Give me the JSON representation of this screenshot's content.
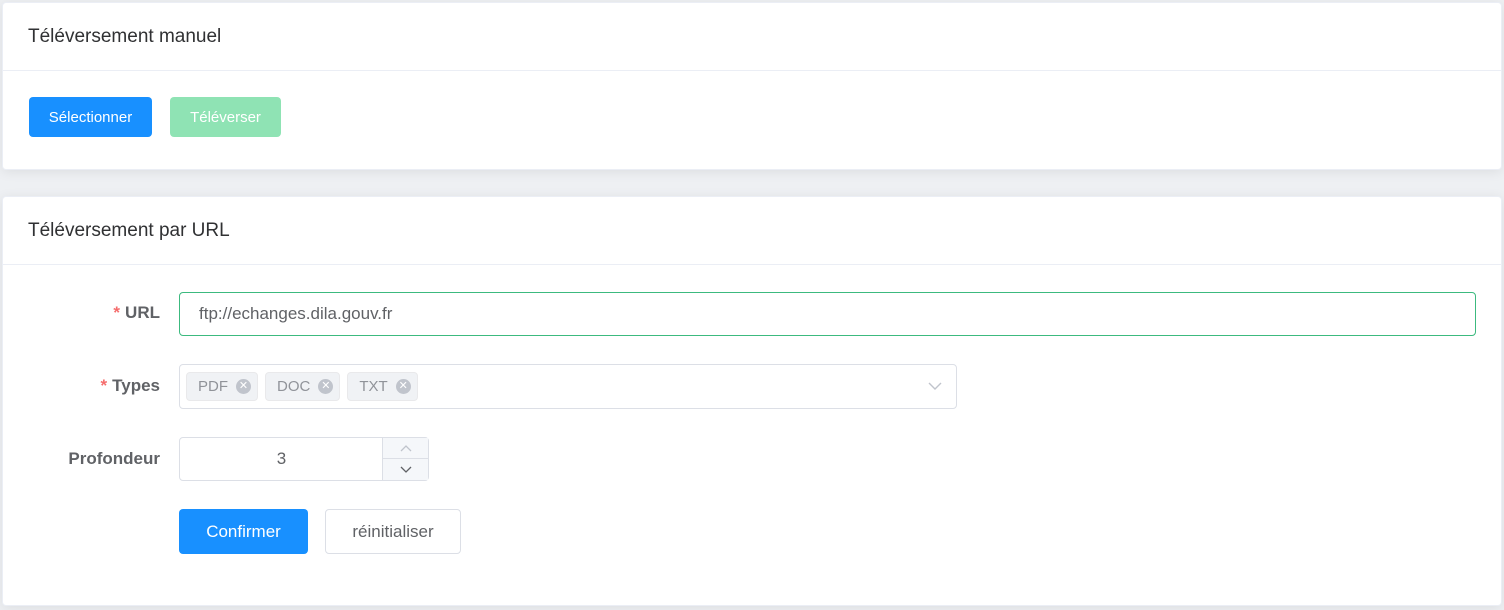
{
  "manual_upload": {
    "title": "Téléversement manuel",
    "select_label": "Sélectionner",
    "upload_label": "Téléverser"
  },
  "url_upload": {
    "title": "Téléversement par URL",
    "url_label": "URL",
    "url_value": "ftp://echanges.dila.gouv.fr",
    "types_label": "Types",
    "types": [
      {
        "label": "PDF"
      },
      {
        "label": "DOC"
      },
      {
        "label": "TXT"
      }
    ],
    "depth_label": "Profondeur",
    "depth_value": "3",
    "required_mark": "*",
    "confirm_label": "Confirmer",
    "reset_label": "réinitialiser"
  },
  "colors": {
    "primary": "#1890ff",
    "success_disabled": "#8fe3b4",
    "required": "#f56c6c",
    "focus_border": "#3cba7f"
  }
}
